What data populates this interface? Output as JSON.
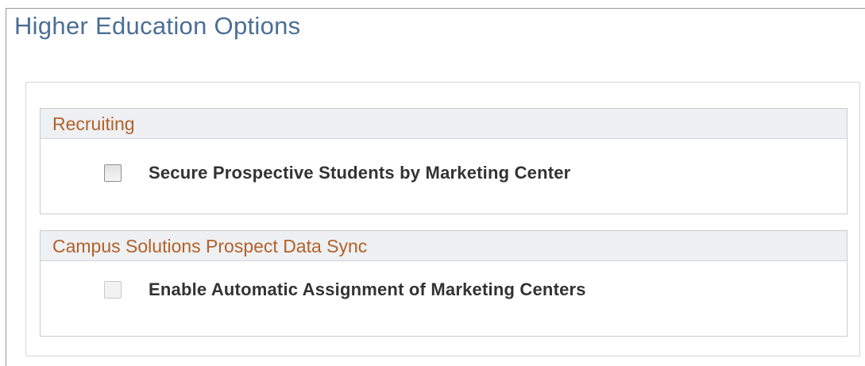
{
  "page": {
    "title": "Higher Education Options"
  },
  "recruiting": {
    "header": "Recruiting",
    "option_label": "Secure Prospective Students by Marketing Center",
    "option_checked": false,
    "option_enabled": true
  },
  "sync": {
    "header": "Campus Solutions Prospect Data Sync",
    "option_label": "Enable Automatic Assignment of Marketing Centers",
    "option_checked": false,
    "option_enabled": false
  },
  "colors": {
    "title": "#4a6f96",
    "group_header_text": "#b3612b",
    "group_header_bg": "#eef0f2",
    "label_text": "#333333"
  }
}
